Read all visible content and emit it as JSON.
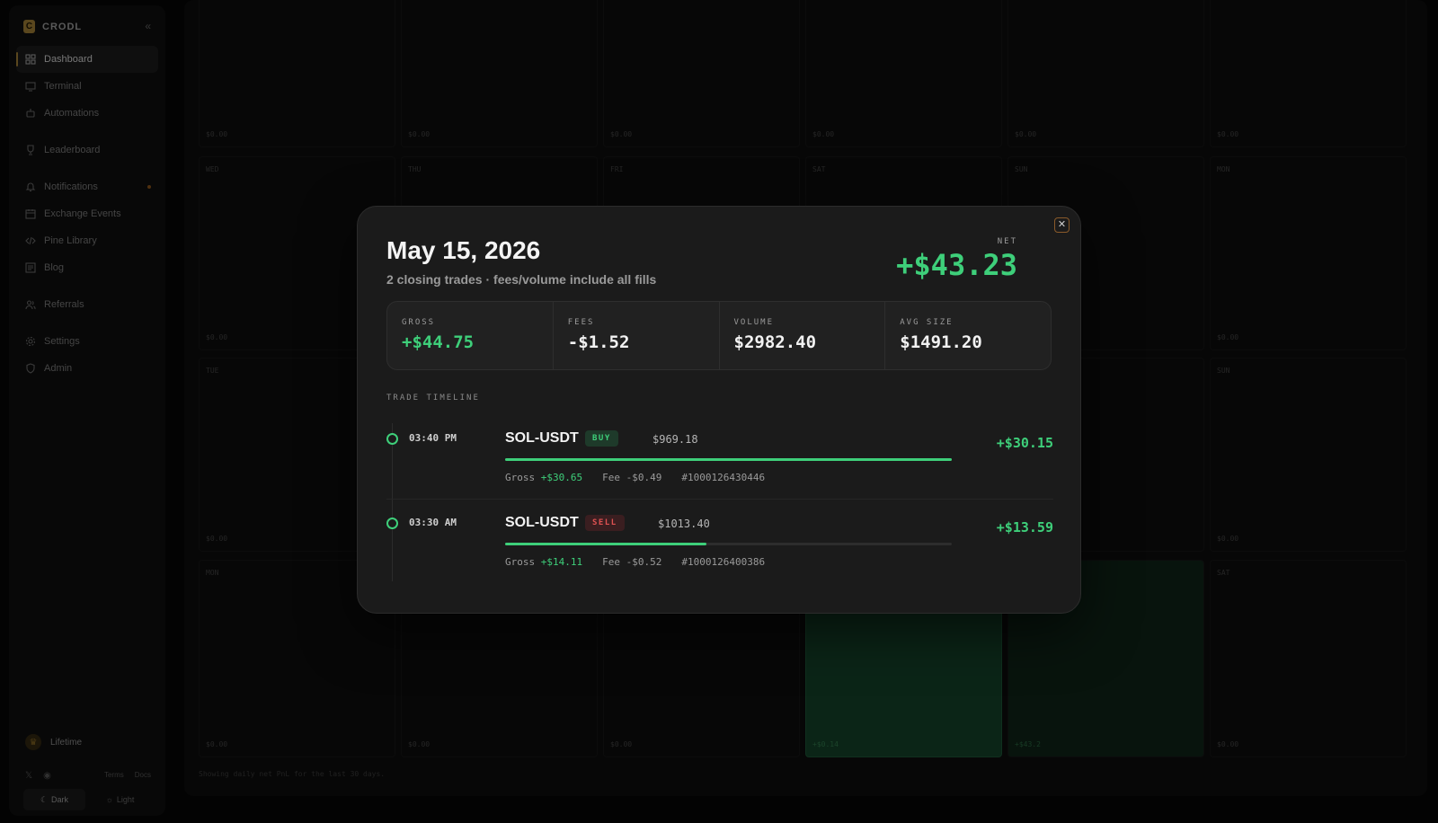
{
  "brand": {
    "name": "CRODL",
    "logo_letter": "C"
  },
  "sidebar": {
    "items": [
      {
        "label": "Dashboard",
        "icon": "grid-icon",
        "active": true
      },
      {
        "label": "Terminal",
        "icon": "monitor-icon"
      },
      {
        "label": "Automations",
        "icon": "robot-icon"
      },
      {
        "label": "Leaderboard",
        "icon": "trophy-icon"
      },
      {
        "label": "Notifications",
        "icon": "bell-icon",
        "dot": true
      },
      {
        "label": "Exchange Events",
        "icon": "calendar-icon"
      },
      {
        "label": "Pine Library",
        "icon": "code-icon"
      },
      {
        "label": "Blog",
        "icon": "newspaper-icon"
      },
      {
        "label": "Referrals",
        "icon": "users-icon"
      },
      {
        "label": "Settings",
        "icon": "gear-icon"
      },
      {
        "label": "Admin",
        "icon": "shield-icon"
      }
    ],
    "lifetime_label": "Lifetime",
    "links": [
      "Terms",
      "Docs"
    ],
    "theme": {
      "dark": "Dark",
      "light": "Light"
    }
  },
  "calendar": {
    "rows": [
      {
        "days": [
          "",
          "",
          "",
          "",
          "",
          ""
        ],
        "amounts": [
          "$0.00",
          "$0.00",
          "$0.00",
          "$0.00",
          "$0.00",
          "$0.00"
        ]
      },
      {
        "days": [
          "WED",
          "THU",
          "FRI",
          "SAT",
          "SUN",
          "MON"
        ],
        "amounts": [
          "$0.00",
          "",
          "",
          "",
          "",
          "$0.00"
        ]
      },
      {
        "days": [
          "TUE",
          "",
          "",
          "",
          "",
          "SUN"
        ],
        "amounts": [
          "$0.00",
          "",
          "",
          "",
          "",
          "$0.00"
        ]
      },
      {
        "days": [
          "MON",
          "",
          "",
          "",
          "",
          "SAT"
        ],
        "amounts": [
          "$0.00",
          "$0.00",
          "$0.00",
          "+$0.14",
          "+$43.2",
          "$0.00"
        ]
      }
    ],
    "footnote": "Showing daily net PnL for the last 30 days."
  },
  "modal": {
    "title": "May 15, 2026",
    "subtitle": "2 closing trades · fees/volume include all fills",
    "net_label": "NET",
    "net_value": "+$43.23",
    "stats": [
      {
        "label": "GROSS",
        "value": "+$44.75",
        "positive": true
      },
      {
        "label": "FEES",
        "value": "-$1.52"
      },
      {
        "label": "VOLUME",
        "value": "$2982.40"
      },
      {
        "label": "AVG SIZE",
        "value": "$1491.20"
      }
    ],
    "timeline_label": "TRADE TIMELINE",
    "trades": [
      {
        "time": "03:40 PM",
        "pair": "SOL-USDT",
        "side": "BUY",
        "size": "$969.18",
        "gross_label": "Gross",
        "gross": "+$30.65",
        "fee_label": "Fee",
        "fee": "-$0.49",
        "id": "#1000126430446",
        "net": "+$30.15",
        "bar_fraction": 1.0
      },
      {
        "time": "03:30 AM",
        "pair": "SOL-USDT",
        "side": "SELL",
        "size": "$1013.40",
        "gross_label": "Gross",
        "gross": "+$14.11",
        "fee_label": "Fee",
        "fee": "-$0.52",
        "id": "#1000126400386",
        "net": "+$13.59",
        "bar_fraction": 0.45
      }
    ]
  },
  "colors": {
    "positive": "#3ecf7a",
    "negative": "#e05252",
    "accent": "#8a6d2e"
  }
}
